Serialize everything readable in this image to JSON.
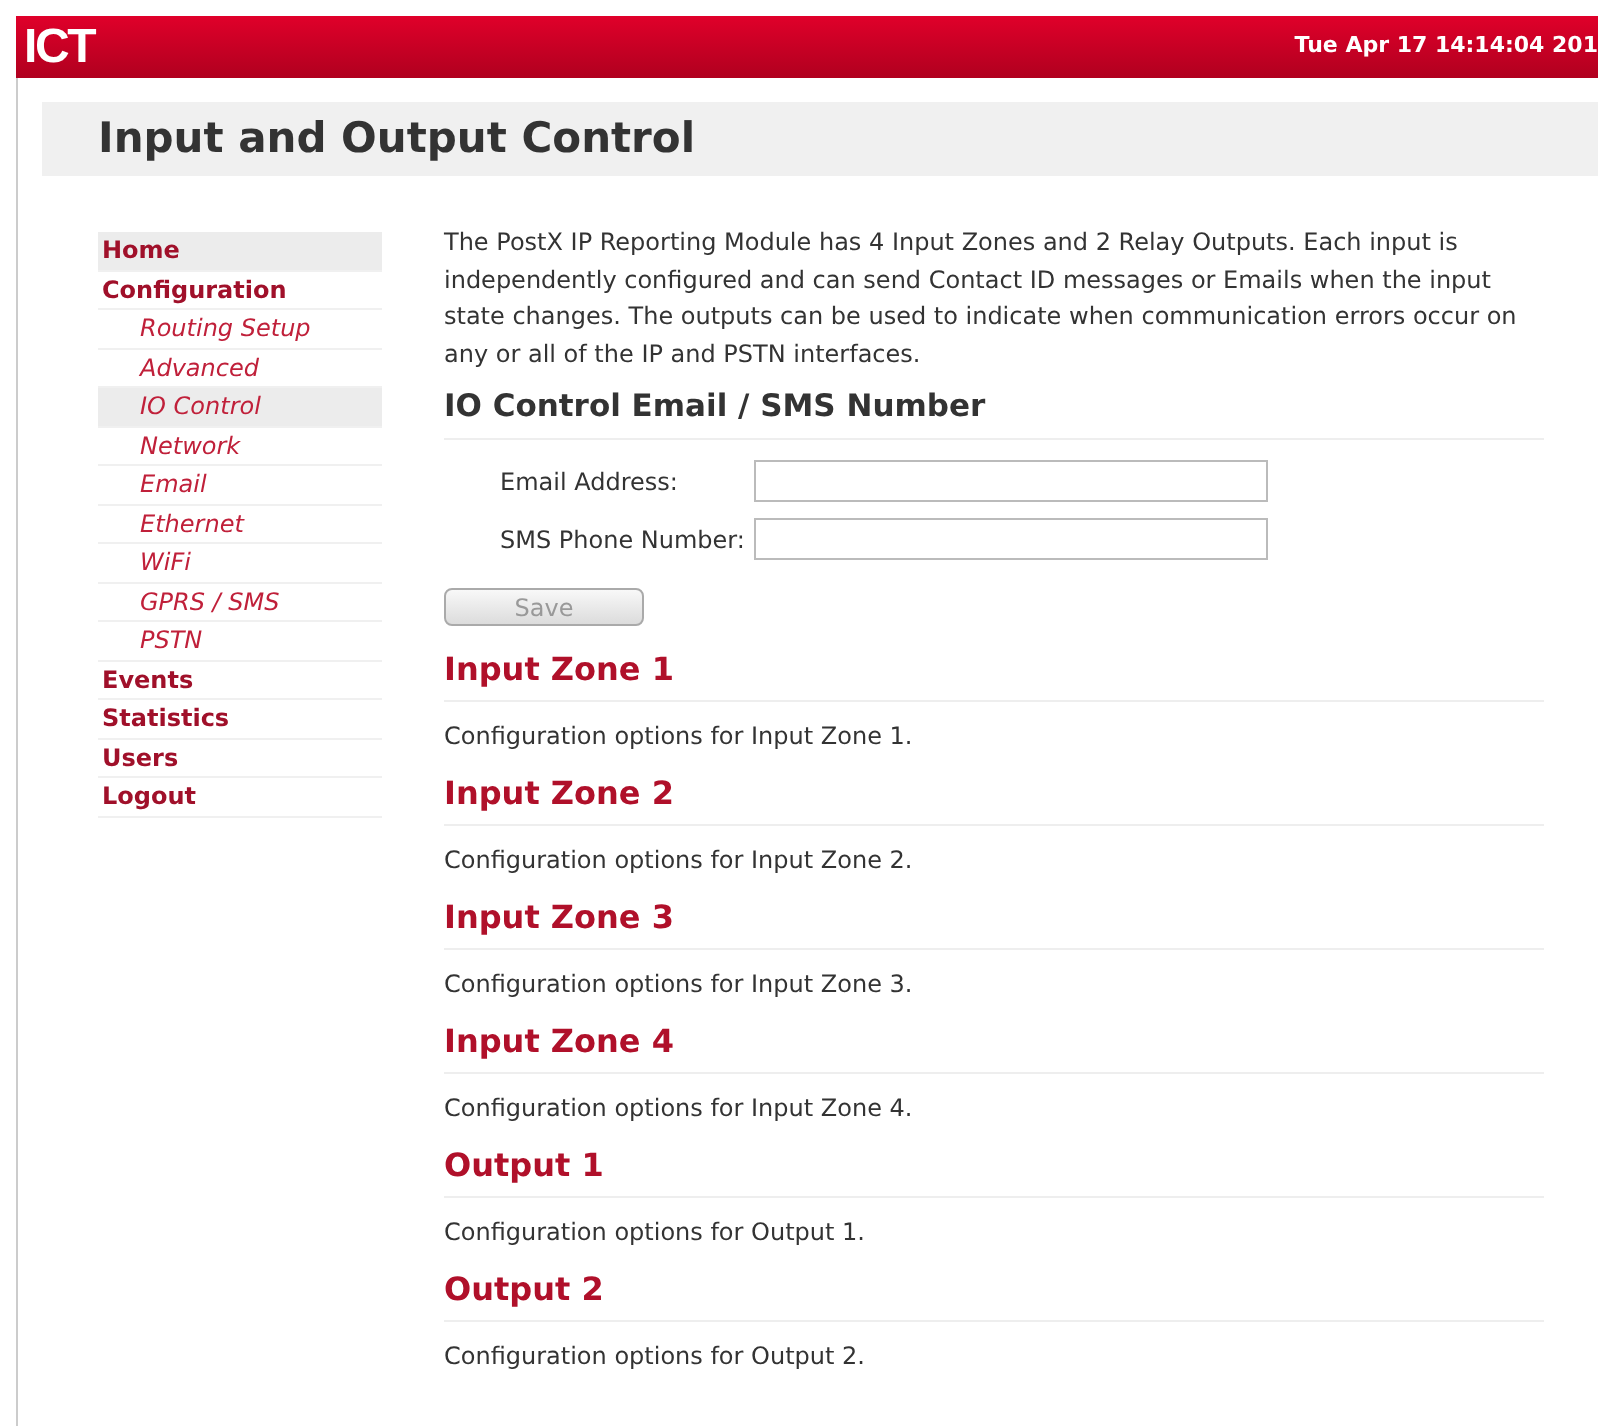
{
  "header": {
    "logo": "ICT",
    "datetime": "Tue Apr 17 14:14:04 201"
  },
  "page_title": "Input and Output Control",
  "sidebar": {
    "items": [
      {
        "label": "Home",
        "selected": true
      },
      {
        "label": "Configuration",
        "selected": false,
        "children": [
          {
            "label": "Routing Setup",
            "selected": false
          },
          {
            "label": "Advanced",
            "selected": false
          },
          {
            "label": "IO Control",
            "selected": true
          },
          {
            "label": "Network",
            "selected": false
          },
          {
            "label": "Email",
            "selected": false
          },
          {
            "label": "Ethernet",
            "selected": false
          },
          {
            "label": "WiFi",
            "selected": false
          },
          {
            "label": "GPRS / SMS",
            "selected": false
          },
          {
            "label": "PSTN",
            "selected": false
          }
        ]
      },
      {
        "label": "Events",
        "selected": false
      },
      {
        "label": "Statistics",
        "selected": false
      },
      {
        "label": "Users",
        "selected": false
      },
      {
        "label": "Logout",
        "selected": false
      }
    ]
  },
  "intro": "The PostX IP Reporting Module has 4 Input Zones and 2 Relay Outputs. Each input is independently configured and can send Contact ID messages or Emails when the input state changes. The outputs can be used to indicate when communication errors occur on any or all of the IP and PSTN interfaces.",
  "form": {
    "heading": "IO Control Email / SMS Number",
    "fields": [
      {
        "label": "Email Address:"
      },
      {
        "label": "SMS Phone Number:"
      }
    ],
    "save_button": {
      "label": "Save",
      "disabled": true
    }
  },
  "sections": [
    {
      "title": "Input Zone 1",
      "description": "Configuration options for Input Zone 1."
    },
    {
      "title": "Input Zone 2",
      "description": "Configuration options for Input Zone 2."
    },
    {
      "title": "Input Zone 3",
      "description": "Configuration options for Input Zone 3."
    },
    {
      "title": "Input Zone 4",
      "description": "Configuration options for Input Zone 4."
    },
    {
      "title": "Output 1",
      "description": "Configuration options for Output 1."
    },
    {
      "title": "Output 2",
      "description": "Configuration options for Output 2."
    }
  ]
}
